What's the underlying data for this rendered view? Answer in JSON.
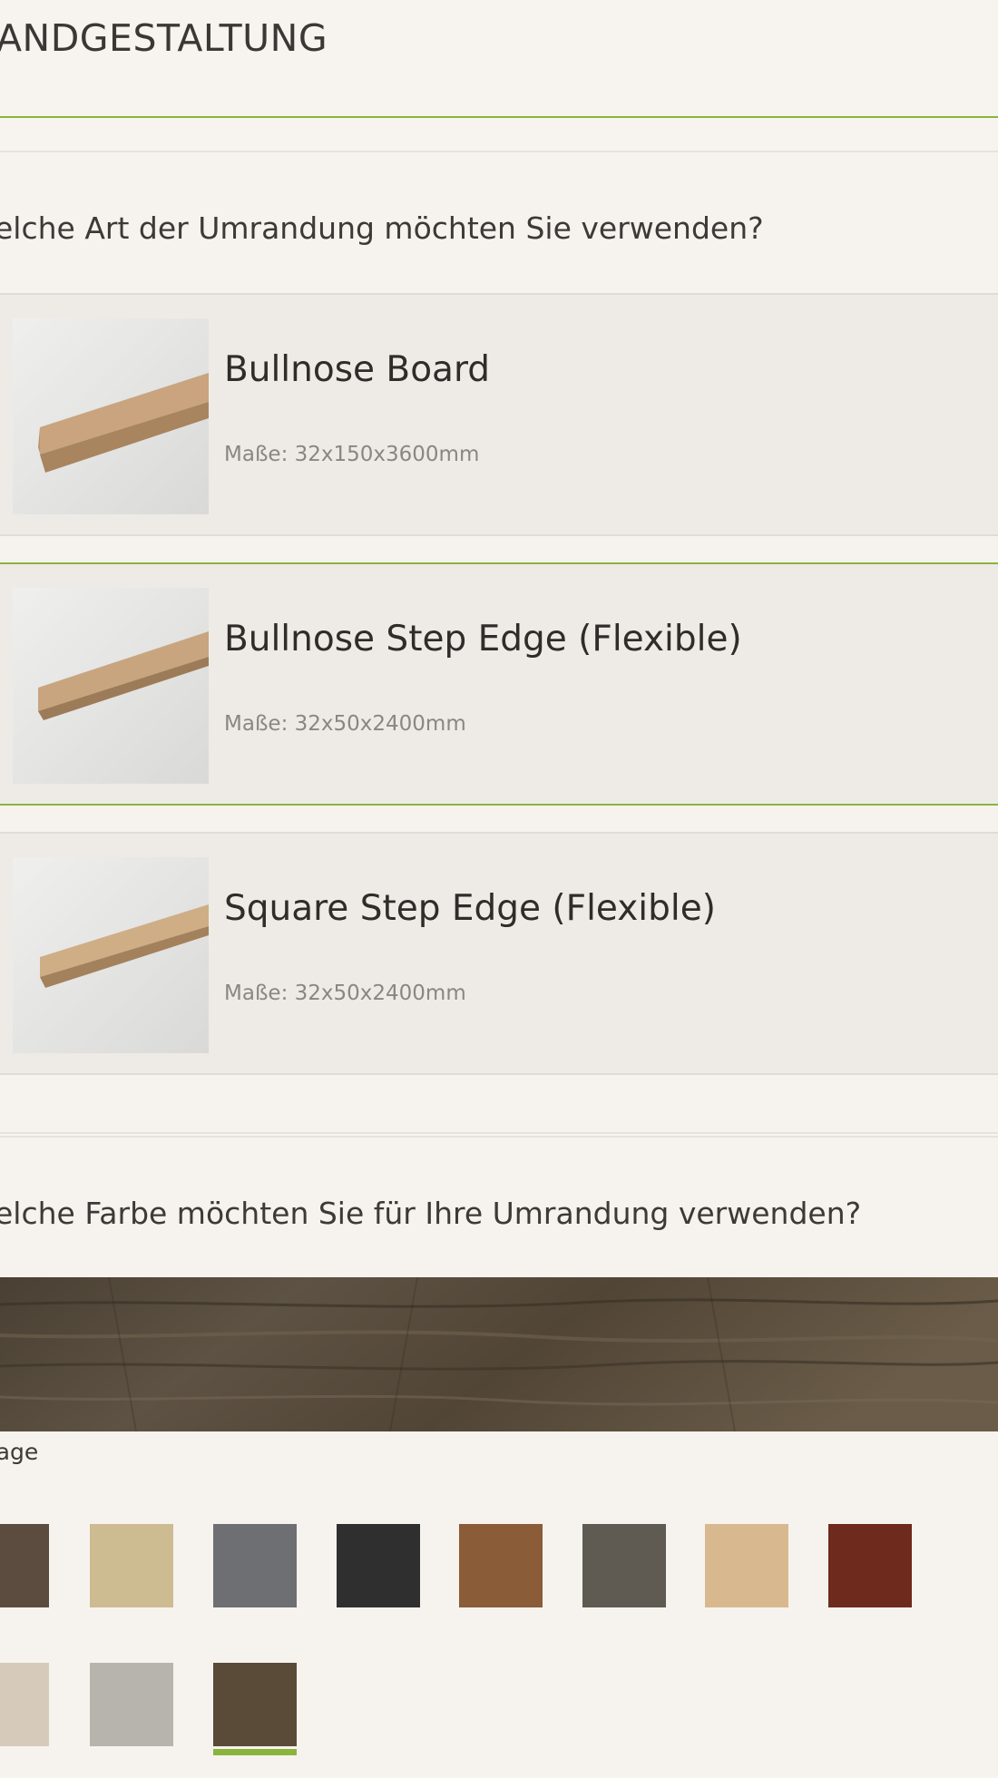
{
  "header": {
    "title": "ANDGESTALTUNG"
  },
  "edge_type": {
    "question": "elche Art der Umrandung möchten Sie verwenden?",
    "options": [
      {
        "title": "Bullnose Board",
        "dims": "Maße: 32x150x3600mm",
        "selected": false
      },
      {
        "title": "Bullnose Step Edge (Flexible)",
        "dims": "Maße: 32x50x2400mm",
        "selected": true
      },
      {
        "title": "Square Step Edge (Flexible)",
        "dims": "Maße: 32x50x2400mm",
        "selected": false
      }
    ]
  },
  "edge_color": {
    "question": "elche Farbe möchten Sie für Ihre Umrandung verwenden?",
    "selected_name": "ntage",
    "swatches_row1": [
      "#5c4c40",
      "#cdbb92",
      "#6d6f72",
      "#2f2f2f",
      "#8a5c37",
      "#5f5a52",
      "#d8b98f",
      "#6e2a1c"
    ],
    "swatches_row2": [
      "#d6cbbb",
      "#b7b4ae",
      "#5a4a38"
    ],
    "selected_index_row2": 2
  },
  "colors": {
    "accent": "#8bb43c",
    "background": "#f7f4ef"
  }
}
